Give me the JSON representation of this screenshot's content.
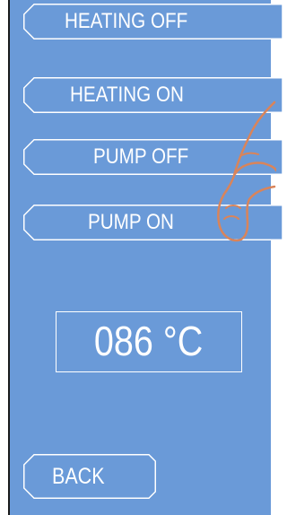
{
  "controls": {
    "heating_off": "HEATING OFF",
    "heating_on": "HEATING ON",
    "pump_off": "PUMP OFF",
    "pump_on": "PUMP ON",
    "back": "BACK"
  },
  "temperature": {
    "value": "086 °C"
  },
  "colors": {
    "panel": "#6a9ad8",
    "outline": "#ffffff",
    "hand_outline": "#d9845a"
  },
  "icons": {
    "pointer": "pointing-hand-icon"
  }
}
